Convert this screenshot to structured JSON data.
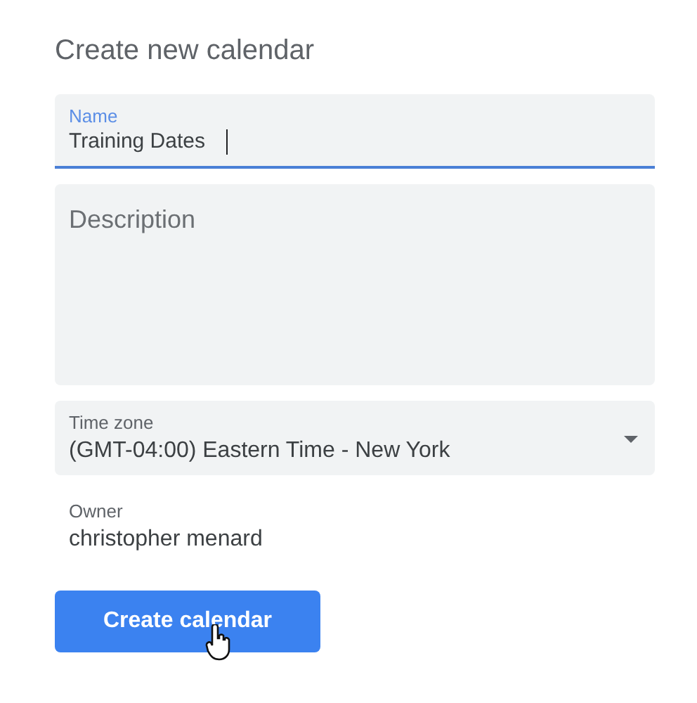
{
  "title": "Create new calendar",
  "name_field": {
    "label": "Name",
    "value": "Training Dates",
    "focused": true
  },
  "description_field": {
    "placeholder": "Description"
  },
  "time_zone": {
    "label": "Time zone",
    "value": "(GMT-04:00) Eastern Time - New York"
  },
  "owner": {
    "label": "Owner",
    "value": "christopher menard"
  },
  "create_button": {
    "label": "Create calendar"
  }
}
